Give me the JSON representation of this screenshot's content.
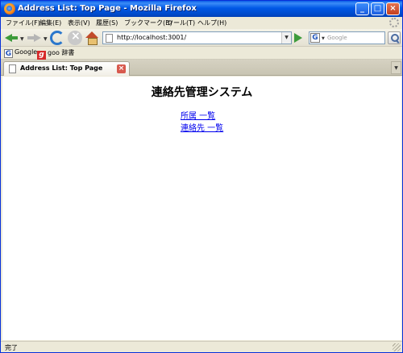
{
  "window": {
    "title": "Address List: Top Page - Mozilla Firefox"
  },
  "menu": [
    {
      "label": "ファイル(F)"
    },
    {
      "label": "編集(E)"
    },
    {
      "label": "表示(V)"
    },
    {
      "label": "履歴(S)"
    },
    {
      "label": "ブックマーク(B)"
    },
    {
      "label": "ツール(T)"
    },
    {
      "label": "ヘルプ(H)"
    }
  ],
  "navigation": {
    "url": "http://localhost:3001/",
    "search_placeholder": "Google"
  },
  "bookmarks": [
    {
      "label": "Google",
      "icon": "google-icon"
    },
    {
      "label": "goo 辞書",
      "icon": "goo-icon"
    }
  ],
  "tabs": [
    {
      "label": "Address List: Top Page",
      "active": true
    }
  ],
  "page": {
    "heading": "連絡先管理システム",
    "links": [
      {
        "label": "所属 一覧"
      },
      {
        "label": "連絡先 一覧"
      }
    ]
  },
  "status": {
    "text": "完了"
  }
}
